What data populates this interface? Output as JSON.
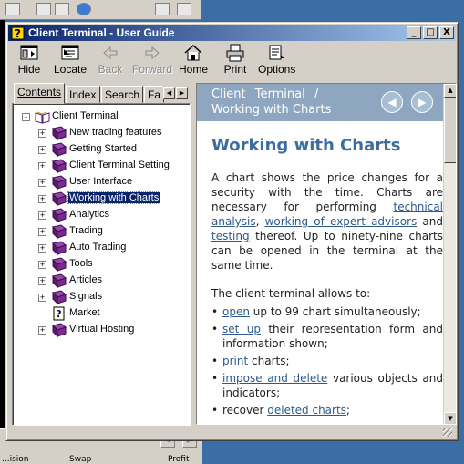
{
  "window": {
    "title": "Client Terminal - User Guide",
    "controls": [
      "_",
      "□",
      "X"
    ]
  },
  "toolbar": {
    "items": [
      {
        "label": "Hide",
        "icon": "hide-icon",
        "enabled": true
      },
      {
        "label": "Locate",
        "icon": "locate-icon",
        "enabled": true
      },
      {
        "label": "Back",
        "icon": "back-arrow-icon",
        "enabled": false
      },
      {
        "label": "Forward",
        "icon": "forward-arrow-icon",
        "enabled": false
      },
      {
        "label": "Home",
        "icon": "home-icon",
        "enabled": true
      },
      {
        "label": "Print",
        "icon": "print-icon",
        "enabled": true
      },
      {
        "label": "Options",
        "icon": "options-icon",
        "enabled": true
      }
    ]
  },
  "nav": {
    "tabs": [
      "Contents",
      "Index",
      "Search",
      "Fa"
    ],
    "active_tab": "Contents",
    "tree_root": "Client Terminal",
    "tree_items": [
      {
        "label": "New trading features",
        "type": "book",
        "expandable": true
      },
      {
        "label": "Getting Started",
        "type": "book",
        "expandable": true
      },
      {
        "label": "Client Terminal Setting",
        "type": "book",
        "expandable": true
      },
      {
        "label": "User Interface",
        "type": "book",
        "expandable": true
      },
      {
        "label": "Working with Charts",
        "type": "book",
        "expandable": true,
        "selected": true
      },
      {
        "label": "Analytics",
        "type": "book",
        "expandable": true
      },
      {
        "label": "Trading",
        "type": "book",
        "expandable": true
      },
      {
        "label": "Auto Trading",
        "type": "book",
        "expandable": true
      },
      {
        "label": "Tools",
        "type": "book",
        "expandable": true
      },
      {
        "label": "Articles",
        "type": "book",
        "expandable": true
      },
      {
        "label": "Signals",
        "type": "book",
        "expandable": true
      },
      {
        "label": "Market",
        "type": "page",
        "expandable": false
      },
      {
        "label": "Virtual Hosting",
        "type": "book",
        "expandable": true
      }
    ]
  },
  "content": {
    "header_line1": "Client Terminal /",
    "header_line2": "Working with Charts",
    "heading": "Working with Charts",
    "intro": {
      "t1": "A chart shows the price changes for a security with the time. Charts are necessary for performing ",
      "link1": "technical analysis",
      "t2": ", ",
      "link2": "working of expert advisors",
      "t3": " and ",
      "link3": "testing",
      "t4": " thereof. Up to ninety-nine charts can be opened in the terminal at the same time."
    },
    "allows_label": "The client terminal allows to:",
    "bullets": [
      {
        "link": "open",
        "text": " up to 99 chart simultaneously;"
      },
      {
        "link": "set up",
        "text": " their representation form and information shown;"
      },
      {
        "link": "print",
        "text": " charts;"
      },
      {
        "link": "impose and delete",
        "text": " various objects and indicators;"
      },
      {
        "pre": "recover ",
        "link": "deleted charts",
        "text": ";"
      }
    ]
  },
  "background_app": {
    "columns": [
      "...ision",
      "Swap",
      "Profit"
    ]
  },
  "colors": {
    "title_gradient_start": "#0a246a",
    "header_band": "#8ea6c0",
    "heading": "#3d6d9e",
    "link": "#2d5a8a",
    "book": "#7b2b8c",
    "selection": "#0a246a",
    "desktop": "#3a6ea5"
  }
}
